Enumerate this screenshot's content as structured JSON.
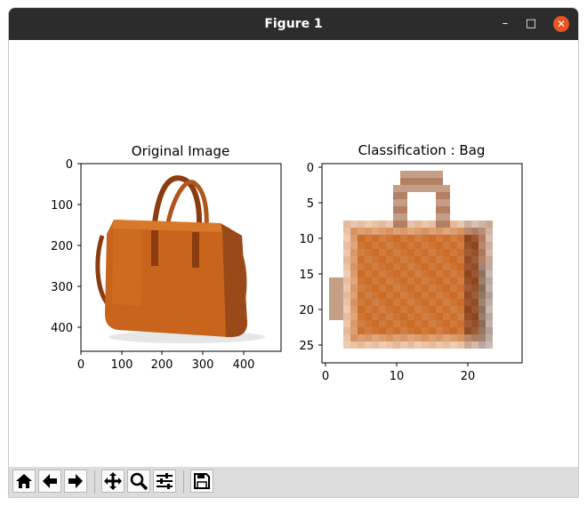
{
  "window": {
    "title": "Figure 1"
  },
  "titlebar_controls": [
    "minimize-icon",
    "maximize-icon",
    "close-icon"
  ],
  "figure": {
    "left_panel": {
      "title": "Original Image",
      "x_ticks": [
        "0",
        "100",
        "200",
        "300",
        "400"
      ],
      "y_ticks": [
        "0",
        "100",
        "200",
        "300",
        "400"
      ],
      "image_size": [
        500,
        459
      ]
    },
    "right_panel": {
      "title": "Classification : Bag",
      "x_ticks": [
        "0",
        "10",
        "20"
      ],
      "y_ticks": [
        "0",
        "5",
        "10",
        "15",
        "20",
        "25"
      ],
      "image_size": [
        28,
        28
      ]
    }
  },
  "toolbar": {
    "buttons": [
      {
        "name": "home-icon"
      },
      {
        "name": "back-icon"
      },
      {
        "name": "forward-icon"
      },
      {
        "name": "pan-icon"
      },
      {
        "name": "zoom-icon"
      },
      {
        "name": "configure-subplots-icon"
      },
      {
        "name": "save-icon"
      }
    ]
  },
  "colors": {
    "bag": "#c8641c",
    "bag_dark": "#8a3c10",
    "bag_shadow": "#5a2a0e",
    "titlebar": "#2c2c2c",
    "close": "#e95420"
  }
}
